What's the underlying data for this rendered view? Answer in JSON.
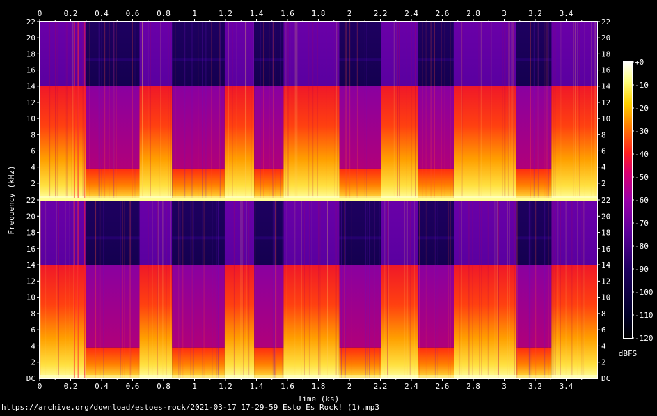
{
  "source_line": "https://archive.org/download/estoes-rock/2021-03-17 17-29-59 Esto Es Rock! (1).mp3",
  "chart_data": {
    "type": "heatmap",
    "title": "",
    "xlabel": "Time (ks)",
    "ylabel": "Frequency (kHz)",
    "x_ticks": [
      "0",
      "0.2",
      "0.4",
      "0.6",
      "0.8",
      "1",
      "1.2",
      "1.4",
      "1.6",
      "1.8",
      "2",
      "2.2",
      "2.4",
      "2.6",
      "2.8",
      "3",
      "3.2",
      "3.4"
    ],
    "x_tick_values": [
      0,
      0.2,
      0.4,
      0.6,
      0.8,
      1,
      1.2,
      1.4,
      1.6,
      1.8,
      2,
      2.2,
      2.4,
      2.6,
      2.8,
      3,
      3.2,
      3.4
    ],
    "xlim": [
      0,
      3.6
    ],
    "y_ticks_top": [
      "22",
      "20",
      "18",
      "16",
      "14",
      "12",
      "10",
      "8",
      "6",
      "4",
      "2"
    ],
    "y_ticks_bottom": [
      "22",
      "20",
      "18",
      "16",
      "14",
      "12",
      "10",
      "8",
      "6",
      "4",
      "2",
      "DC"
    ],
    "y_tick_values": [
      22,
      20,
      18,
      16,
      14,
      12,
      10,
      8,
      6,
      4,
      2
    ],
    "ylim": [
      0,
      22
    ],
    "channels": 2,
    "lowpass_cutoff_khz": 14,
    "colorbar": {
      "label": "dBFS",
      "ticks": [
        "+0",
        "-10",
        "-20",
        "-30",
        "-40",
        "-50",
        "-60",
        "-70",
        "-80",
        "-90",
        "-100",
        "-110",
        "-120"
      ],
      "values": [
        0,
        -10,
        -20,
        -30,
        -40,
        -50,
        -60,
        -70,
        -80,
        -90,
        -100,
        -110,
        -120
      ],
      "range": [
        -120,
        0
      ],
      "colors": [
        "#ffffff",
        "#ffff80",
        "#ffd000",
        "#ff8000",
        "#ff2020",
        "#d8006e",
        "#9a00a8",
        "#5a0098",
        "#1e0060",
        "#000028",
        "#000000"
      ]
    },
    "segments": [
      {
        "start": 0.0,
        "end": 0.3,
        "level": "loud"
      },
      {
        "start": 0.3,
        "end": 0.645,
        "level": "quiet"
      },
      {
        "start": 0.645,
        "end": 0.855,
        "level": "loud"
      },
      {
        "start": 0.855,
        "end": 1.195,
        "level": "quiet"
      },
      {
        "start": 1.195,
        "end": 1.385,
        "level": "loud"
      },
      {
        "start": 1.385,
        "end": 1.575,
        "level": "quiet"
      },
      {
        "start": 1.575,
        "end": 1.935,
        "level": "loud"
      },
      {
        "start": 1.935,
        "end": 2.205,
        "level": "quiet"
      },
      {
        "start": 2.205,
        "end": 2.445,
        "level": "loud"
      },
      {
        "start": 2.445,
        "end": 2.675,
        "level": "quiet"
      },
      {
        "start": 2.675,
        "end": 3.075,
        "level": "loud"
      },
      {
        "start": 3.075,
        "end": 3.305,
        "level": "quiet"
      },
      {
        "start": 3.305,
        "end": 3.6,
        "level": "loud"
      }
    ]
  }
}
